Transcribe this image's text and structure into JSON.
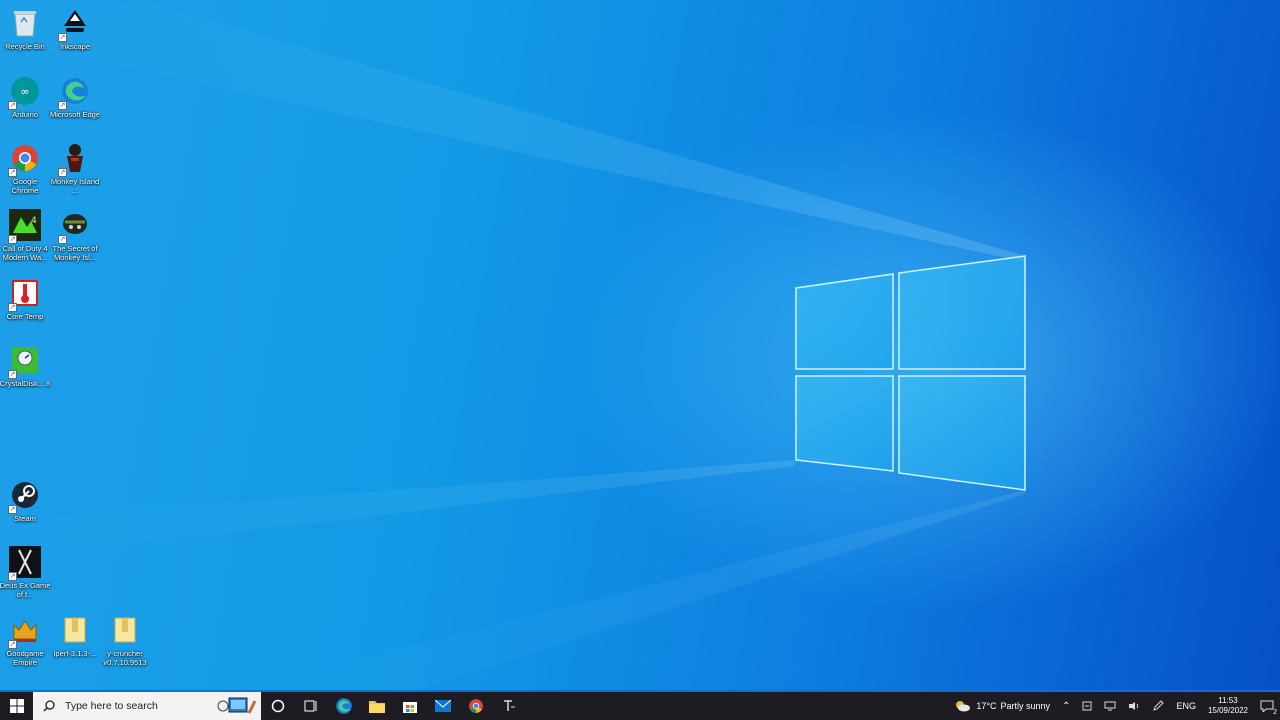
{
  "desktop": {
    "icons": [
      {
        "label": "Recycle Bin",
        "icon": "recycle-bin-icon"
      },
      {
        "label": "Inkscape",
        "icon": "inkscape-icon"
      },
      {
        "label": "Arduino",
        "icon": "arduino-icon"
      },
      {
        "label": "Microsoft Edge",
        "icon": "edge-icon"
      },
      {
        "label": "Google Chrome",
        "icon": "chrome-icon"
      },
      {
        "label": "Monkey Island ...",
        "icon": "monkey-island-icon"
      },
      {
        "label": "Call of Duty 4 Modern Wa...",
        "icon": "call-of-duty-icon"
      },
      {
        "label": "The Secret of Monkey Isl...",
        "icon": "secret-monkey-island-icon"
      },
      {
        "label": "Core Temp",
        "icon": "core-temp-icon"
      },
      {
        "label": "CrystalDisk... 8",
        "icon": "crystaldisk-icon"
      },
      {
        "label": "Steam",
        "icon": "steam-icon"
      },
      {
        "label": "Deus Ex Game of t...",
        "icon": "deus-ex-icon"
      },
      {
        "label": "Goodgame Empire",
        "icon": "goodgame-empire-icon"
      },
      {
        "label": "iperf-3.1.3-...",
        "icon": "folder-icon"
      },
      {
        "label": "y-cruncher v0.7.10.9513",
        "icon": "folder-icon"
      }
    ]
  },
  "taskbar": {
    "search_placeholder": "Type here to search",
    "pinned": [
      "task-view",
      "edge",
      "file-explorer",
      "microsoft-store",
      "mail",
      "chrome",
      "throttlestop"
    ],
    "weather": {
      "temp": "17°C",
      "condition": "Partly sunny"
    },
    "language": "ENG",
    "time": "11:53",
    "date": "15/09/2022",
    "notification_count": "2"
  },
  "colors": {
    "taskbar_bg": "#1c1c22",
    "wallpaper_light": "#1ea0e8",
    "wallpaper_dark": "#0650c8"
  }
}
